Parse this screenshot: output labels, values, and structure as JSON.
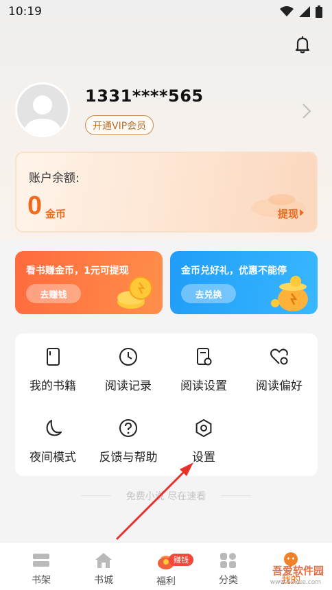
{
  "status_bar": {
    "time": "10:19"
  },
  "profile": {
    "phone": "1331****565",
    "vip_label": "开通VIP会员"
  },
  "balance": {
    "label": "账户余额:",
    "value": "0",
    "unit": "金币",
    "withdraw_label": "提现"
  },
  "promos": [
    {
      "title": "看书赚金币，1元可提现",
      "button": "去赚钱"
    },
    {
      "title": "金币兑好礼，优惠不能停",
      "button": "去兑换"
    }
  ],
  "menu": [
    {
      "label": "我的书籍",
      "icon": "book-icon"
    },
    {
      "label": "阅读记录",
      "icon": "clock-icon"
    },
    {
      "label": "阅读设置",
      "icon": "reading-settings-icon"
    },
    {
      "label": "阅读偏好",
      "icon": "heart-settings-icon"
    },
    {
      "label": "夜间模式",
      "icon": "moon-icon"
    },
    {
      "label": "反馈与帮助",
      "icon": "help-icon"
    },
    {
      "label": "设置",
      "icon": "hexagon-settings-icon"
    }
  ],
  "footer_text": "免费小说 尽在速看",
  "bottom_nav": [
    {
      "label": "书架",
      "icon": "bookshelf-icon"
    },
    {
      "label": "书城",
      "icon": "home-icon"
    },
    {
      "label": "福利",
      "icon": "gift-bag-icon",
      "badge": "赚钱"
    },
    {
      "label": "分类",
      "icon": "grid-icon"
    },
    {
      "label": "我的",
      "icon": "profile-icon"
    }
  ],
  "watermark": {
    "text": "吾爱软件园",
    "sub": "www.52xue.com"
  },
  "colors": {
    "accent": "#f06b1f",
    "promo_orange": "#ff6a3d",
    "promo_blue": "#1f9df7",
    "annotation_red": "#e8312c"
  }
}
